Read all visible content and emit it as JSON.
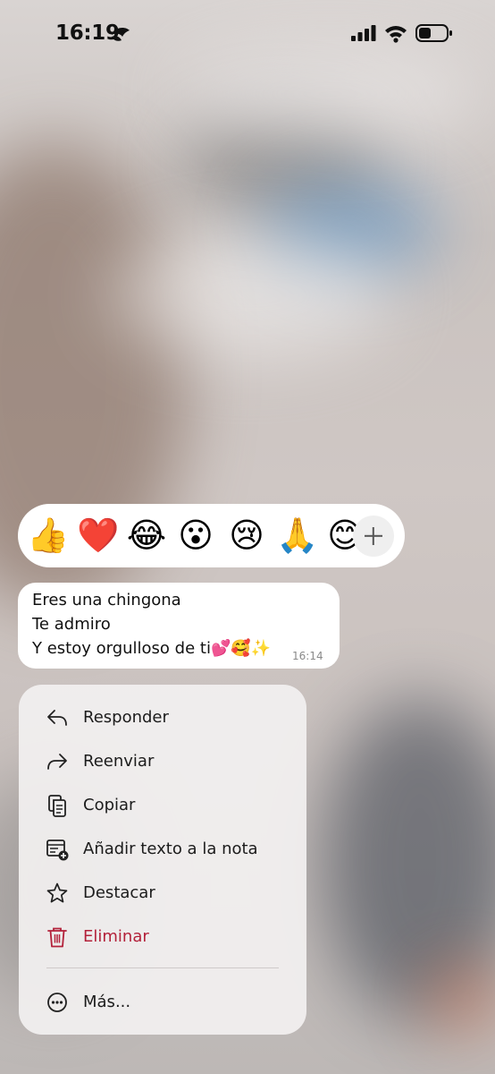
{
  "status_bar": {
    "time": "16:19"
  },
  "reactions": {
    "emojis": [
      "👍",
      "❤️",
      "😂",
      "😮",
      "😢",
      "🙏",
      "😊"
    ]
  },
  "message": {
    "lines": [
      "Eres una chingona",
      "Te admiro",
      "Y estoy orgulloso de ti💕🥰✨"
    ],
    "time": "16:14"
  },
  "menu": {
    "items": [
      {
        "label": "Responder",
        "icon": "reply-icon"
      },
      {
        "label": "Reenviar",
        "icon": "forward-icon"
      },
      {
        "label": "Copiar",
        "icon": "copy-icon"
      },
      {
        "label": "Añadir texto a la nota",
        "icon": "add-to-note-icon"
      },
      {
        "label": "Destacar",
        "icon": "star-icon"
      },
      {
        "label": "Eliminar",
        "icon": "trash-icon"
      }
    ],
    "more_label": "Más..."
  },
  "colors": {
    "danger": "#b3213a",
    "menu_bg": "#f2f0f0"
  }
}
